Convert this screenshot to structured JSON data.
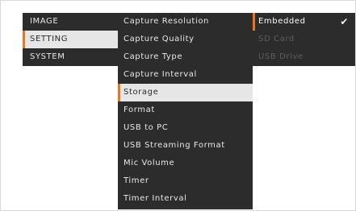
{
  "main_menu": {
    "items": [
      {
        "label": "IMAGE"
      },
      {
        "label": "SETTING"
      },
      {
        "label": "SYSTEM"
      }
    ]
  },
  "setting_menu": {
    "items": [
      {
        "label": "Capture Resolution"
      },
      {
        "label": "Capture Quality"
      },
      {
        "label": "Capture Type"
      },
      {
        "label": "Capture Interval"
      },
      {
        "label": "Storage"
      },
      {
        "label": "Format"
      },
      {
        "label": "USB to PC"
      },
      {
        "label": "USB Streaming Format"
      },
      {
        "label": "Mic Volume"
      },
      {
        "label": "Timer"
      },
      {
        "label": "Timer Interval"
      }
    ]
  },
  "storage_options": {
    "items": [
      {
        "label": "Embedded",
        "checked": true,
        "check_glyph": "✔"
      },
      {
        "label": "SD Card",
        "disabled": true
      },
      {
        "label": "USB Drive",
        "disabled": true
      }
    ]
  },
  "colors": {
    "menu_background": "#2c2c2c",
    "selected_background": "#e6e6e6",
    "accent": "#e8761e",
    "disabled_text": "#5e5e5e"
  }
}
